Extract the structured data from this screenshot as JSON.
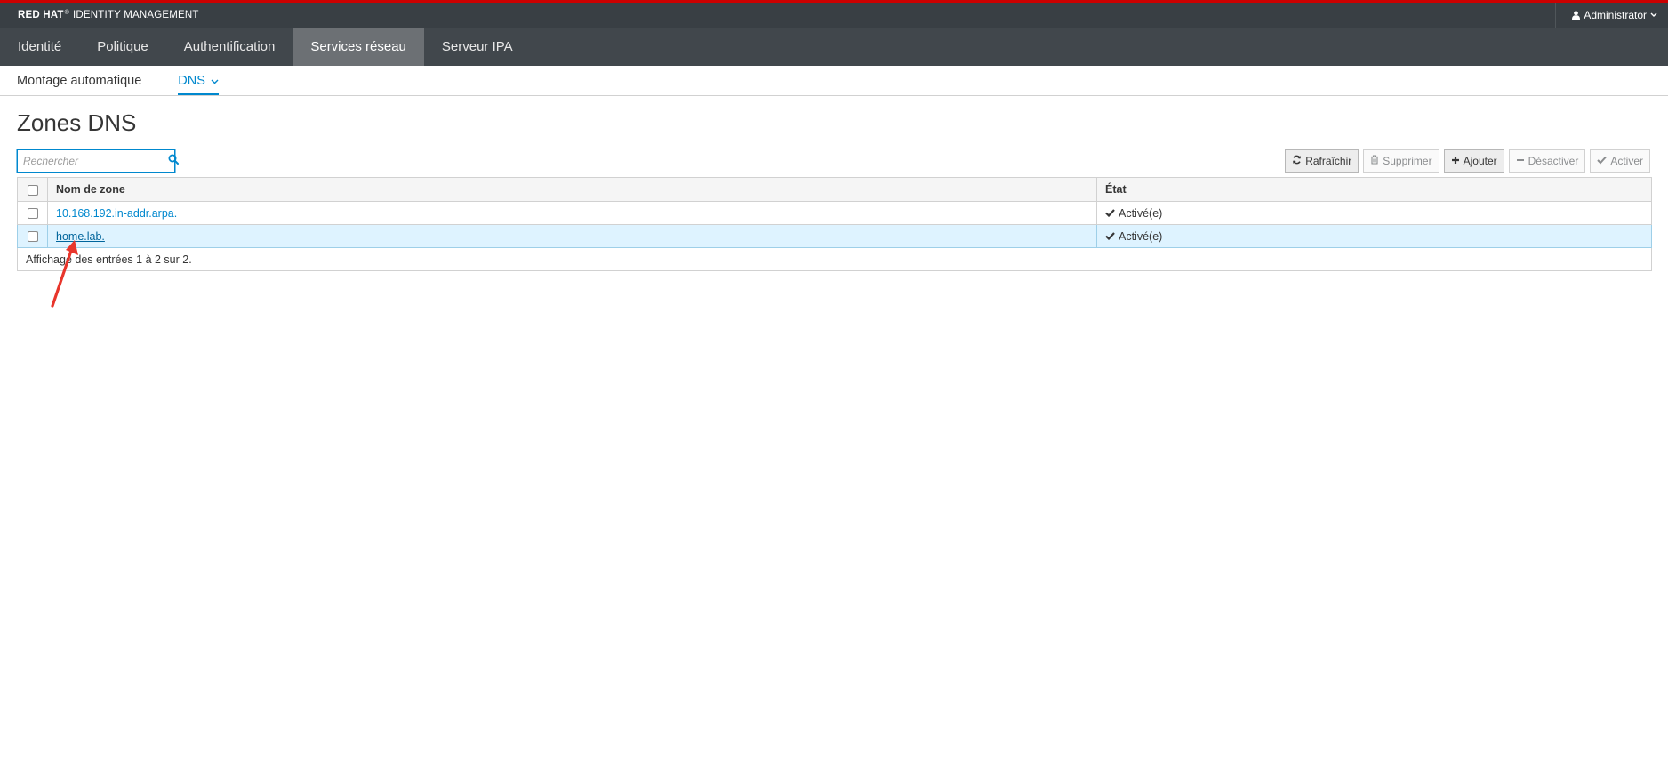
{
  "header": {
    "brand_bold": "RED HAT",
    "brand_light": "IDENTITY MANAGEMENT",
    "user": "Administrator"
  },
  "main_nav": [
    {
      "label": "Identité",
      "active": false
    },
    {
      "label": "Politique",
      "active": false
    },
    {
      "label": "Authentification",
      "active": false
    },
    {
      "label": "Services réseau",
      "active": true
    },
    {
      "label": "Serveur IPA",
      "active": false
    }
  ],
  "sub_nav": [
    {
      "label": "Montage automatique",
      "active": false
    },
    {
      "label": "DNS",
      "active": true
    }
  ],
  "page": {
    "title": "Zones DNS"
  },
  "search": {
    "placeholder": "Rechercher",
    "value": ""
  },
  "toolbar": {
    "refresh": "Rafraîchir",
    "delete": "Supprimer",
    "add": "Ajouter",
    "disable": "Désactiver",
    "enable": "Activer"
  },
  "table": {
    "columns": [
      "Nom de zone",
      "État"
    ],
    "rows": [
      {
        "name": "10.168.192.in-addr.arpa.",
        "state": "Activé(e)",
        "selected": false
      },
      {
        "name": "home.lab.",
        "state": "Activé(e)",
        "selected": true
      }
    ],
    "footer": "Affichage des entrées 1 à 2 sur 2."
  },
  "colors": {
    "accent": "#0088ce",
    "header_bg": "#393f44",
    "nav_bg": "#41474c",
    "nav_active_bg": "#6c7074",
    "brand_red": "#cc0000",
    "annotation_arrow": "#e8352b",
    "selected_row_bg": "#def3ff"
  },
  "icons": {
    "user": "user-icon",
    "search": "search-icon",
    "refresh": "refresh-icon",
    "delete": "trash-icon",
    "add": "plus-icon",
    "disable": "minus-icon",
    "enable": "check-icon",
    "state": "check-icon"
  }
}
